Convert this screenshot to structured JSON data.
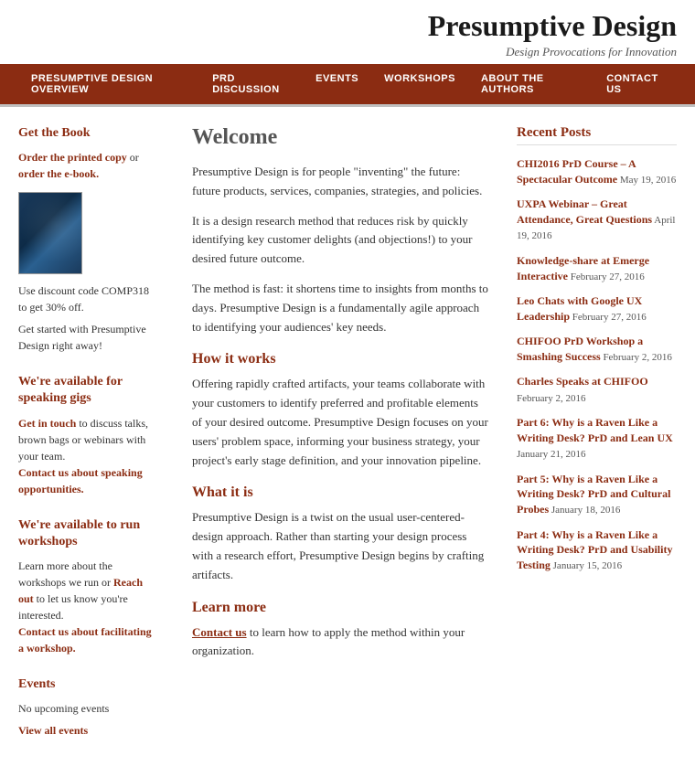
{
  "site": {
    "title": "Presumptive Design",
    "tagline": "Design Provocations for Innovation"
  },
  "nav": {
    "items": [
      {
        "label": "PRESUMPTIVE DESIGN OVERVIEW",
        "href": "#"
      },
      {
        "label": "PRD DISCUSSION",
        "href": "#"
      },
      {
        "label": "EVENTS",
        "href": "#"
      },
      {
        "label": "WORKSHOPS",
        "href": "#"
      },
      {
        "label": "ABOUT THE AUTHORS",
        "href": "#"
      },
      {
        "label": "CONTACT US",
        "href": "#"
      }
    ]
  },
  "left_sidebar": {
    "sections": [
      {
        "id": "get-the-book",
        "title": "Get the Book",
        "lines": [
          {
            "type": "link-text",
            "parts": [
              "Order the printed copy",
              " or ",
              "order the e-book."
            ]
          },
          {
            "type": "text",
            "text": "Use discount code COMP318 to get 30% off."
          },
          {
            "type": "text",
            "text": "Get started with Presumptive Design right away!"
          }
        ]
      },
      {
        "id": "speaking-gigs",
        "title": "We're available for speaking gigs",
        "lines": [
          {
            "type": "text",
            "text": "Get in touch to discuss talks, brown bags or webinars with your team."
          },
          {
            "type": "link",
            "text": "Contact us about speaking opportunities."
          }
        ]
      },
      {
        "id": "run-workshops",
        "title": "We're available to run workshops",
        "lines": [
          {
            "type": "text",
            "text": "Learn more about the workshops we run or Reach out to let us know you're interested."
          },
          {
            "type": "link",
            "text": "Contact us about facilitating a workshop."
          }
        ]
      },
      {
        "id": "events",
        "title": "Events",
        "lines": [
          {
            "type": "text",
            "text": "No upcoming events"
          },
          {
            "type": "link",
            "text": "View all events"
          }
        ]
      }
    ]
  },
  "main_content": {
    "welcome_title": "Welcome",
    "welcome_paragraphs": [
      "Presumptive Design is for people \"inventing\" the future: future products, services, companies, strategies, and policies.",
      "It is a design research method that reduces risk by quickly identifying key customer delights (and objections!) to your desired future outcome.",
      "The method is fast: it shortens time to insights from months to days. Presumptive Design is a fundamentally agile approach to identifying your audiences' key needs."
    ],
    "how_it_works_title": "How it works",
    "how_it_works_text": "Offering rapidly crafted artifacts, your teams collaborate with your customers to identify preferred and profitable elements of your desired outcome. Presumptive Design focuses on your users' problem space, informing your business strategy, your project's early stage definition, and your innovation pipeline.",
    "what_it_is_title": "What it is",
    "what_it_is_text": "Presumptive Design is a twist on the usual user-centered-design approach. Rather than starting your design process with a research effort, Presumptive Design begins by crafting artifacts.",
    "learn_more_title": "Learn more",
    "learn_more_text": "Contact us to learn how to apply the method within your organization."
  },
  "right_sidebar": {
    "title": "Recent Posts",
    "posts": [
      {
        "title": "CHI2016 PrD Course – A Spectacular Outcome",
        "date": "May 19, 2016"
      },
      {
        "title": "UXPA Webinar – Great Attendance, Great Questions",
        "date": "April 19, 2016"
      },
      {
        "title": "Knowledge-share at Emerge Interactive",
        "date": "February 27, 2016"
      },
      {
        "title": "Leo Chats with Google UX Leadership",
        "date": "February 27, 2016"
      },
      {
        "title": "CHIFOO PrD Workshop a Smashing Success",
        "date": "February 2, 2016"
      },
      {
        "title": "Charles Speaks at CHIFOO",
        "date": "February 2, 2016"
      },
      {
        "title": "Part 6: Why is a Raven Like a Writing Desk? PrD and Lean UX",
        "date": "January 21, 2016"
      },
      {
        "title": "Part 5: Why is a Raven Like a Writing Desk? PrD and Cultural Probes",
        "date": "January 18, 2016"
      },
      {
        "title": "Part 4: Why is a Raven Like a Writing Desk? PrD and Usability Testing",
        "date": "January 15, 2016"
      }
    ]
  }
}
